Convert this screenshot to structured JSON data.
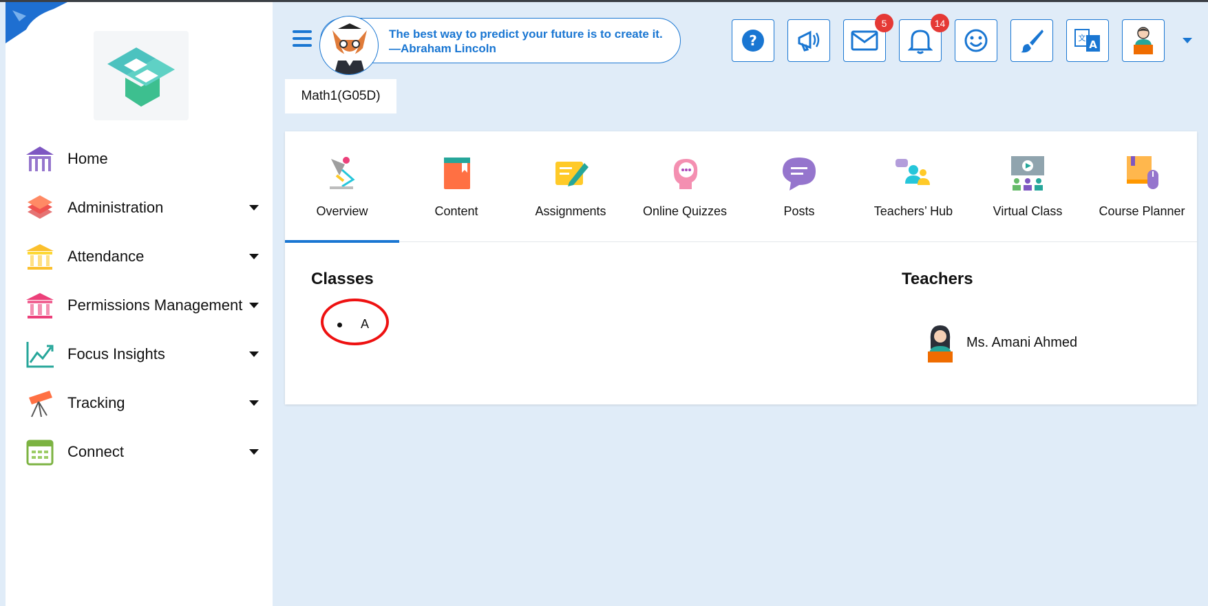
{
  "header": {
    "quote_line1": "The best way to predict your future is to create it.",
    "quote_line2": "—Abraham Lincoln",
    "tools": [
      {
        "name": "help-icon",
        "badge": null
      },
      {
        "name": "megaphone-icon",
        "badge": null
      },
      {
        "name": "mail-icon",
        "badge": "5"
      },
      {
        "name": "bell-icon",
        "badge": "14"
      },
      {
        "name": "smiley-icon",
        "badge": null
      },
      {
        "name": "brush-icon",
        "badge": null
      },
      {
        "name": "translate-icon",
        "badge": null
      },
      {
        "name": "user-avatar-icon",
        "badge": null
      }
    ]
  },
  "sidebar": {
    "items": [
      {
        "label": "Home",
        "icon": "home-building-icon"
      },
      {
        "label": "Administration",
        "icon": "layers-icon"
      },
      {
        "label": "Attendance",
        "icon": "bank-icon"
      },
      {
        "label": "Permissions Management",
        "icon": "bank-icon"
      },
      {
        "label": "Focus Insights",
        "icon": "chart-icon"
      },
      {
        "label": "Tracking",
        "icon": "telescope-icon"
      },
      {
        "label": "Connect",
        "icon": "calendar-icon"
      }
    ]
  },
  "course": {
    "name": "Math1(G05D)"
  },
  "tabs": [
    {
      "label": "Overview",
      "icon": "desk-lamp-icon",
      "active": true
    },
    {
      "label": "Content",
      "icon": "book-icon"
    },
    {
      "label": "Assignments",
      "icon": "pen-paper-icon"
    },
    {
      "label": "Online Quizzes",
      "icon": "head-chat-icon"
    },
    {
      "label": "Posts",
      "icon": "chat-bubble-icon"
    },
    {
      "label": "Teachers’ Hub",
      "icon": "people-chat-icon"
    },
    {
      "label": "Virtual Class",
      "icon": "presentation-icon"
    },
    {
      "label": "Course Planner",
      "icon": "book-mouse-icon"
    }
  ],
  "overview": {
    "classes_title": "Classes",
    "classes": [
      "A"
    ],
    "teachers_title": "Teachers",
    "teachers": [
      "Ms. Amani Ahmed"
    ]
  },
  "colors": {
    "accent": "#1976d2",
    "badge": "#e53935",
    "background": "#e0ecf8"
  }
}
